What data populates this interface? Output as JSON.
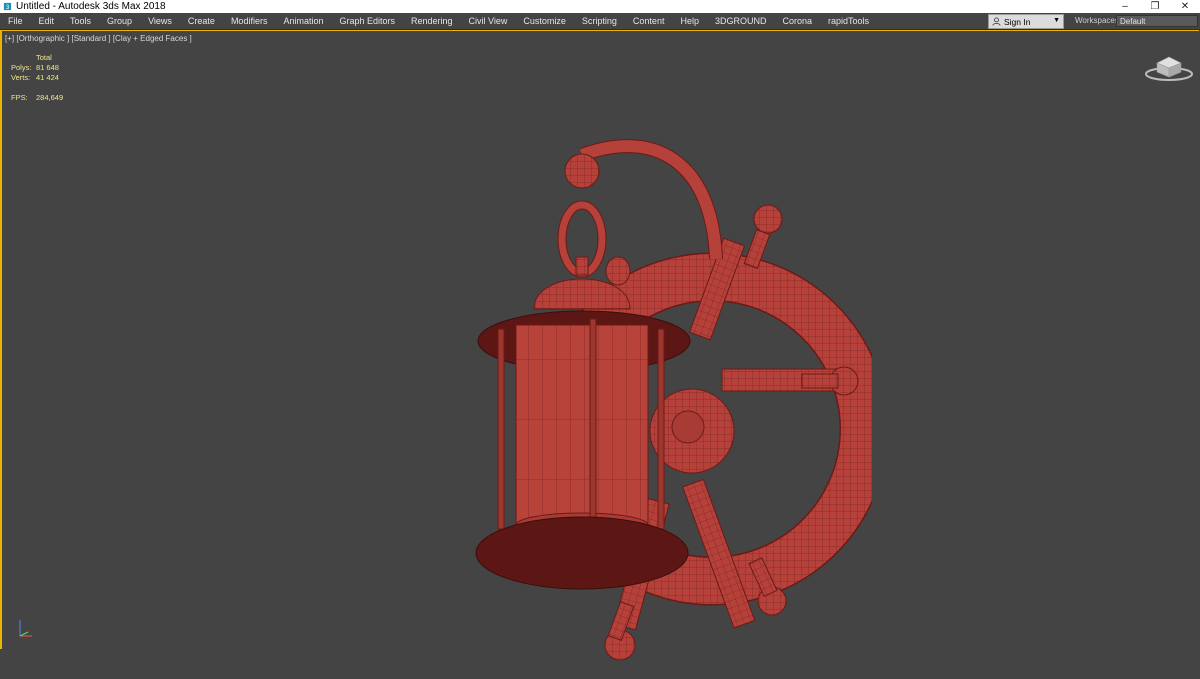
{
  "window": {
    "title": "Untitled - Autodesk 3ds Max 2018",
    "controls": [
      "–",
      "❐",
      "✕"
    ]
  },
  "menu": [
    "File",
    "Edit",
    "Tools",
    "Group",
    "Views",
    "Create",
    "Modifiers",
    "Animation",
    "Graph Editors",
    "Rendering",
    "Civil View",
    "Customize",
    "Scripting",
    "Content",
    "Help",
    "3DGROUND",
    "Corona",
    "rapidTools"
  ],
  "signin": {
    "label": "Sign In"
  },
  "workspaces": {
    "label": "Workspaces:",
    "value": "Default"
  },
  "viewport": {
    "label": "[+] [Orthographic ] [Standard ] [Clay + Edged Faces ]",
    "stats": {
      "header": "Total",
      "polys_label": "Polys:",
      "polys": "81 648",
      "verts_label": "Verts:",
      "verts": "41 424",
      "fps_label": "FPS:",
      "fps": "284,649"
    }
  },
  "colors": {
    "accent": "#e8b600",
    "model": "#b5413a",
    "background": "#444444"
  }
}
